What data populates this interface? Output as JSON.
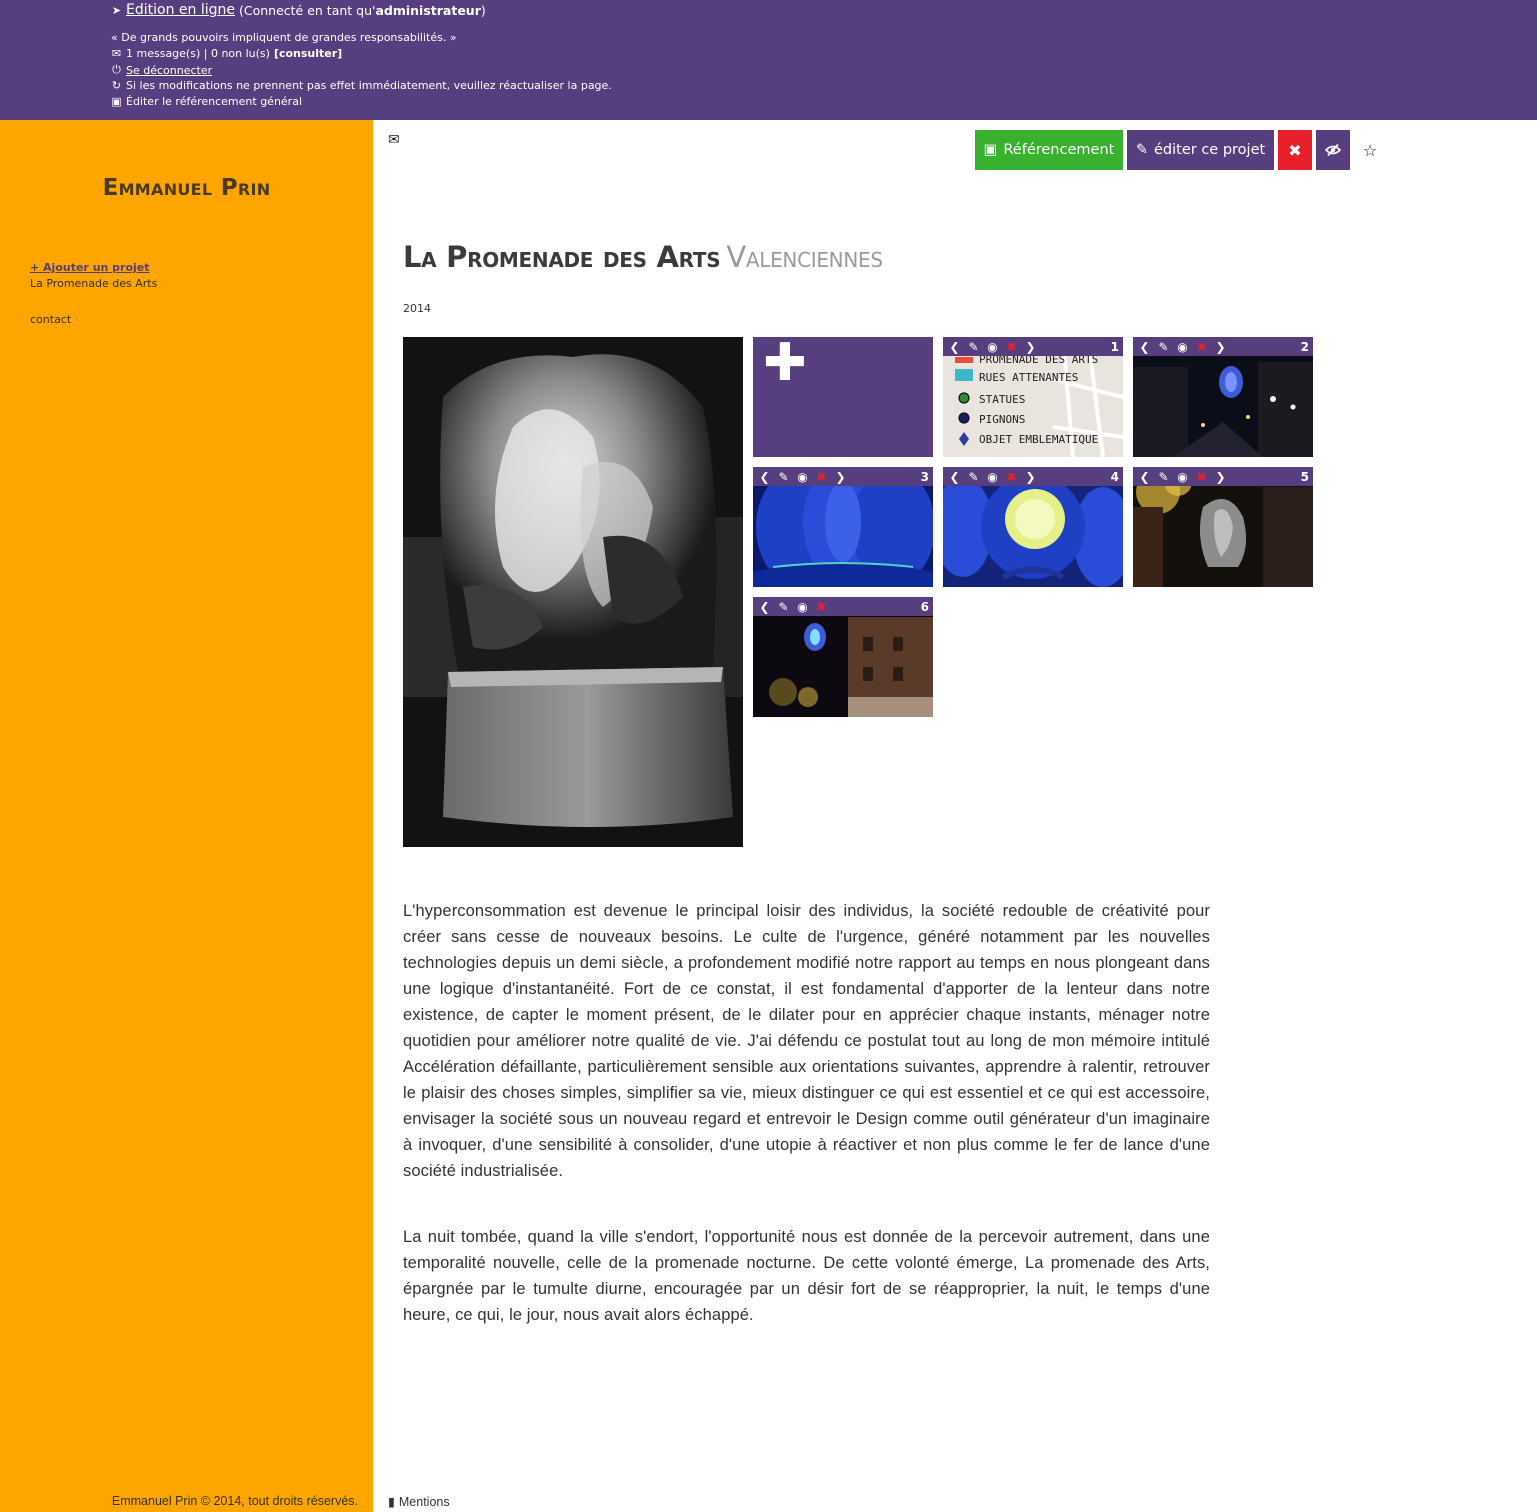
{
  "adminbar": {
    "edit_link": "Edition en ligne",
    "connected_prefix": "(Connecté en tant qu'",
    "connected_user": "administrateur",
    "connected_suffix": ")",
    "quote": "« De grands pouvoirs impliquent de grandes responsabilités. »",
    "messages": "1 message(s) | 0 non lu(s)",
    "messages_link": "[consulter]",
    "logout": "Se déconnecter",
    "refresh_notice": "Si les modifications ne prennent pas effet immédiatement, veuillez réactualiser la page.",
    "seo_general": "Éditer le référencement général"
  },
  "sidebar": {
    "site_title": "Emmanuel Prin",
    "add_project": "+ Ajouter un projet",
    "items": [
      {
        "label": "La Promenade des Arts"
      },
      {
        "label": "contact"
      }
    ],
    "copyright": "Emmanuel Prin © 2014, tout droits réservés."
  },
  "toolbar": {
    "referencement_label": "Référencement",
    "edit_label": "éditer ce projet",
    "delete_icon": "close-icon",
    "visibility_icon": "eye-slash-icon",
    "favorite_icon": "star-icon"
  },
  "project": {
    "title": "La Promenade des Arts",
    "city": "Valenciennes",
    "year": "2014",
    "paragraphs": [
      "L'hyperconsommation est devenue le principal loisir des individus, la société redouble de créativité pour créer sans cesse de nouveaux besoins. Le culte de l'urgence, généré notamment par les nouvelles technologies depuis un demi siècle, a profondement modifié notre rapport au temps en nous plongeant dans une logique d'instantanéité. Fort de ce constat, il est fondamental d'apporter de la lenteur dans notre existence, de capter le moment présent, de le dilater pour en apprécier chaque instants, ménager notre quotidien pour améliorer notre qualité de vie. J'ai défendu ce postulat tout au long de mon mémoire intitulé Accélération défaillante, particulièrement sensible aux orientations suivantes, apprendre à ralentir, retrouver le plaisir des choses simples, simplifier sa vie, mieux distinguer ce qui est essentiel et ce qui est accessoire, envisager la société sous un nouveau regard et entrevoir le Design comme outil générateur d'un imaginaire à invoquer, d'une sensibilité à consolider, d'une utopie à réactiver et non plus comme le fer de lance d'une société industrialisée.",
      "La nuit tombée, quand la ville s'endort, l'opportunité nous est donnée de la percevoir autrement, dans une temporalité nouvelle, celle de la promenade nocturne. De cette volonté émerge, La promenade des Arts, épargnée par le tumulte diurne, encouragée par un désir fort de se réapproprier, la nuit, le temps d'une heure, ce qui, le jour, nous avait alors échappé."
    ]
  },
  "gallery": {
    "add_icon": "plus-icon",
    "thumbnails": [
      {
        "number": "1",
        "legend": [
          "PROMENADE DES ARTS",
          "RUES ATTENANTES",
          "STATUES",
          "PIGNONS",
          "OBJET EMBLEMATIQUE"
        ]
      },
      {
        "number": "2"
      },
      {
        "number": "3"
      },
      {
        "number": "4"
      },
      {
        "number": "5"
      },
      {
        "number": "6"
      }
    ]
  },
  "footer": {
    "mentions": "Mentions"
  },
  "colors": {
    "purple": "#573f7f",
    "orange": "#ffa500",
    "green": "#39b12e",
    "red": "#e8202b"
  }
}
